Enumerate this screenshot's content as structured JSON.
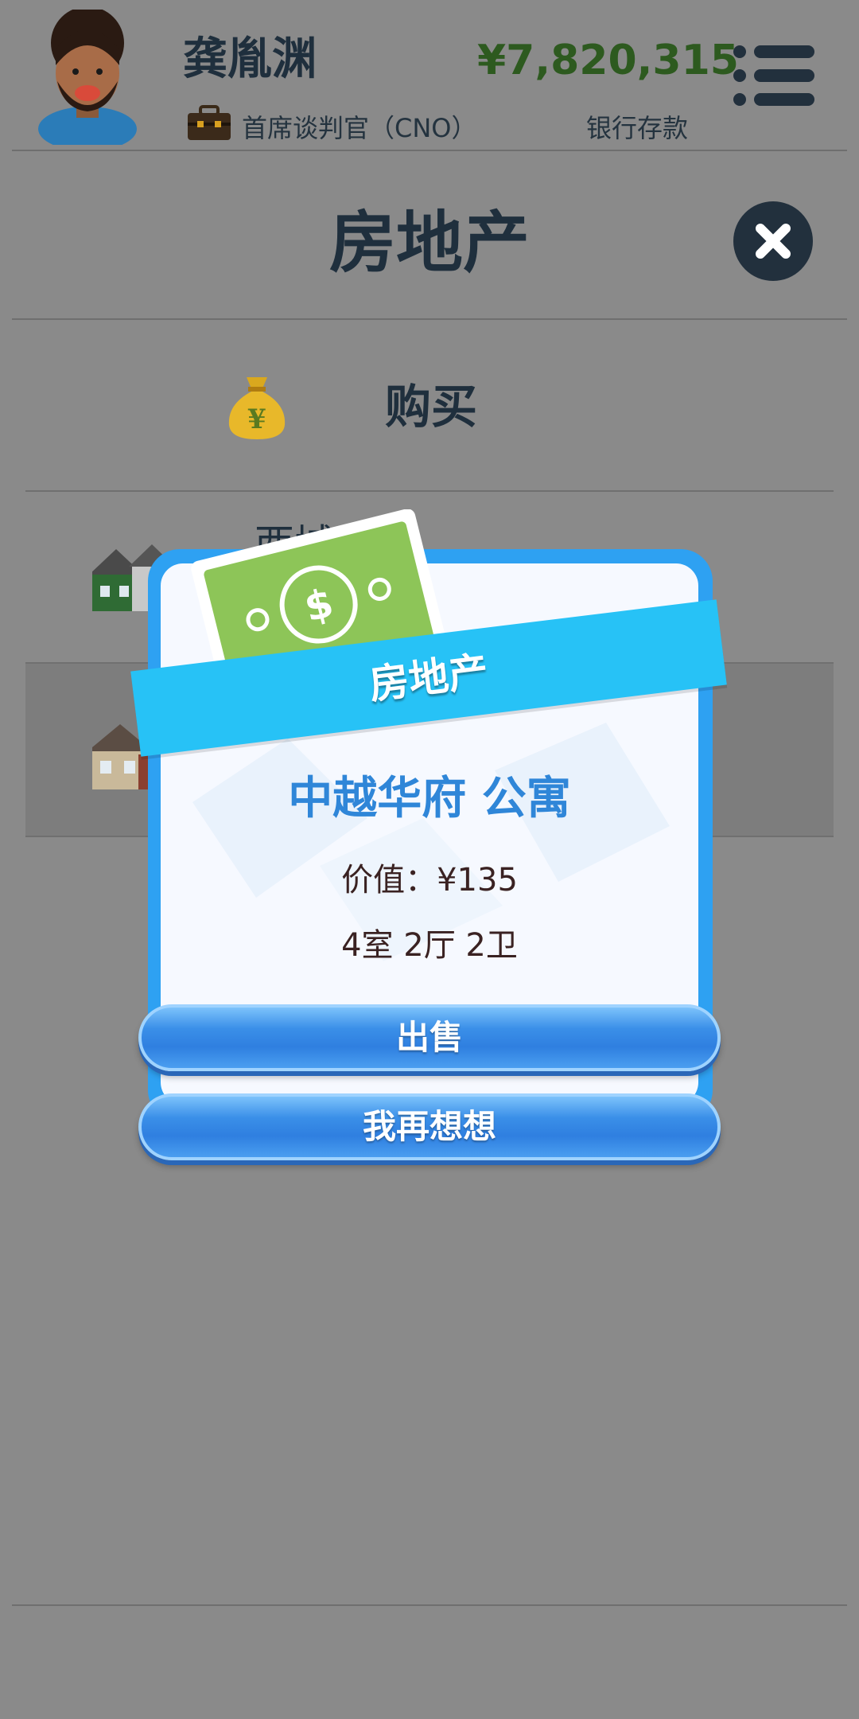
{
  "player": {
    "name": "龚胤渊",
    "job_title": "首席谈判官（CNO）",
    "money": "¥7,820,315",
    "money_label": "银行存款"
  },
  "page": {
    "title": "房地产",
    "buy_label": "购买"
  },
  "list": {
    "rows": [
      {
        "label": "西城"
      },
      {
        "label": ""
      }
    ]
  },
  "modal": {
    "banner": "房地产",
    "property_name": "中越华府 公寓",
    "value": "价值：¥135",
    "rooms": "4室 2厅 2卫",
    "sell_button": "出售",
    "cancel_button": "我再想想",
    "bill_symbol": "$"
  },
  "colors": {
    "accent": "#2ea1f2",
    "ribbon": "#27c2f6",
    "money": "#2d5a1f",
    "property_name": "#2f86d8"
  }
}
